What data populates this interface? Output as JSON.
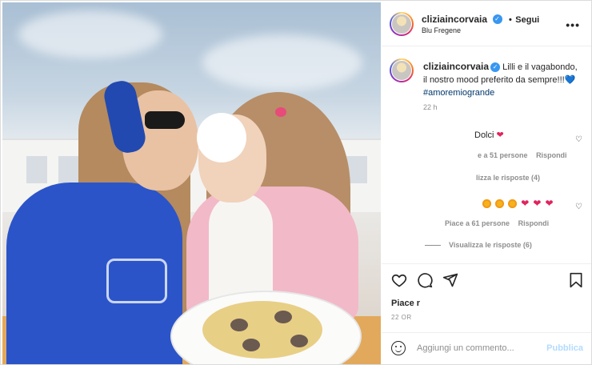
{
  "post": {
    "username": "cliziaincorvaia",
    "follow_label": "Segui",
    "location": "Blu Fregene",
    "more_label": "•••",
    "photo_alt": ""
  },
  "caption": {
    "username": "cliziaincorvaia",
    "text": "Lilli e il vagabondo, il nostro mood preferito da sempre!!!",
    "emoji": "💙",
    "hashtag": "#amoremiogrande",
    "time": "22 h"
  },
  "comments": [
    {
      "text": "Dolci",
      "emoji": "❤",
      "likes_label": "e a 51 persone",
      "reply_label": "Rispondi",
      "view_replies": "lizza le risposte (4)"
    },
    {
      "text": "",
      "emoji_row": [
        "star",
        "star",
        "star",
        "heart",
        "heart",
        "heart"
      ],
      "likes_label": "Piace a 61 persone",
      "reply_label": "Rispondi",
      "view_replies": "Visualizza le risposte (6)"
    }
  ],
  "actions": {
    "like_icon": "heart-icon",
    "comment_icon": "comment-icon",
    "share_icon": "share-icon",
    "save_icon": "bookmark-icon"
  },
  "likes_text": "Piace r",
  "date_text": "22 OR",
  "add_comment": {
    "placeholder": "Aggiungi un commento...",
    "publish_label": "Pubblica"
  },
  "colors": {
    "verified": "#3897f0",
    "hashtag": "#00376b",
    "publish_disabled": "#b3dbff",
    "heart": "#e0245e"
  }
}
